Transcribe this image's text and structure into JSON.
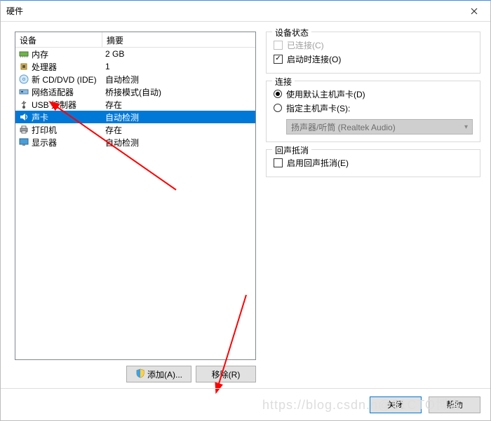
{
  "window": {
    "title": "硬件"
  },
  "list": {
    "header_device": "设备",
    "header_summary": "摘要",
    "rows": [
      {
        "icon": "memory",
        "name": "内存",
        "summary": "2 GB",
        "selected": false
      },
      {
        "icon": "cpu",
        "name": "处理器",
        "summary": "1",
        "selected": false
      },
      {
        "icon": "cd",
        "name": "新 CD/DVD (IDE)",
        "summary": "自动检测",
        "selected": false
      },
      {
        "icon": "nic",
        "name": "网络适配器",
        "summary": "桥接模式(自动)",
        "selected": false
      },
      {
        "icon": "usb",
        "name": "USB 控制器",
        "summary": "存在",
        "selected": false
      },
      {
        "icon": "sound",
        "name": "声卡",
        "summary": "自动检测",
        "selected": true
      },
      {
        "icon": "printer",
        "name": "打印机",
        "summary": "存在",
        "selected": false
      },
      {
        "icon": "display",
        "name": "显示器",
        "summary": "自动检测",
        "selected": false
      }
    ]
  },
  "left_buttons": {
    "add": "添加(A)...",
    "remove": "移除(R)"
  },
  "groups": {
    "status": {
      "title": "设备状态",
      "connected": "已连接(C)",
      "connect_at_poweron": "启动时连接(O)"
    },
    "connection": {
      "title": "连接",
      "use_default": "使用默认主机声卡(D)",
      "specify": "指定主机声卡(S):",
      "combo_value": "扬声器/听筒 (Realtek Audio)"
    },
    "echo": {
      "title": "回声抵消",
      "enable": "启用回声抵消(E)"
    }
  },
  "footer": {
    "close": "关闭",
    "help": "帮助"
  },
  "watermark": "https://blog.csdn.n@51CTO博客"
}
